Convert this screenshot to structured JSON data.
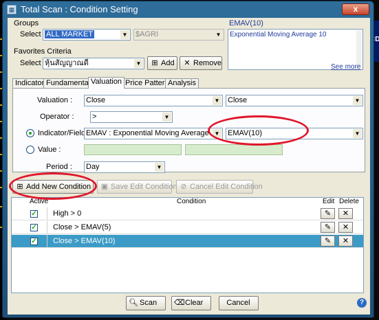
{
  "window": {
    "title": "Total Scan : Condition Setting",
    "close_label": "x"
  },
  "background": {
    "right_text": "CD"
  },
  "groups": {
    "label": "Groups",
    "select_label": "Select :",
    "market_value": "ALL MARKET",
    "sector_value": "$AGRI"
  },
  "favorites": {
    "label": "Favorites Criteria",
    "select_label": "Select :",
    "value": "หุ้นสัญญาณดี",
    "add_label": "Add",
    "remove_label": "Remove"
  },
  "info": {
    "title": "EMAV(10)",
    "description": "Exponential Moving Average 10",
    "see_more": "See more"
  },
  "tabs": [
    {
      "label": "Indicator",
      "active": false
    },
    {
      "label": "Fundamental",
      "active": false
    },
    {
      "label": "Valuation",
      "active": true
    },
    {
      "label": "Price Pattern",
      "active": false
    },
    {
      "label": "Analysis",
      "active": false
    }
  ],
  "form": {
    "valuation_label": "Valuation :",
    "valuation_value1": "Close",
    "valuation_value2": "Close",
    "operator_label": "Operator :",
    "operator_value": ">",
    "indicator_label": "Indicator/Field :",
    "indicator_value": "EMAV : Exponential Moving Average",
    "indicator_param": "EMAV(10)",
    "indicator_selected": true,
    "value_label": "Value :",
    "period_label": "Period :",
    "period_value": "Day"
  },
  "actions": {
    "add_new": "Add New Condition",
    "save_edit": "Save Edit Condition",
    "cancel_edit": "Cancel Edit Condition"
  },
  "grid": {
    "headers": {
      "active": "Active",
      "condition": "Condition",
      "edit": "Edit",
      "delete": "Delete"
    },
    "rows": [
      {
        "active": true,
        "condition": "High > 0",
        "selected": false
      },
      {
        "active": true,
        "condition": "Close > EMAV(5)",
        "selected": false
      },
      {
        "active": true,
        "condition": "Close > EMAV(10)",
        "selected": true
      }
    ]
  },
  "footer": {
    "scan": "Scan",
    "clear": "Clear",
    "cancel": "Cancel"
  },
  "colors": {
    "highlight": "#e0162b",
    "selected_row": "#3b9bc6",
    "title_bar": "#2f6d9a"
  }
}
